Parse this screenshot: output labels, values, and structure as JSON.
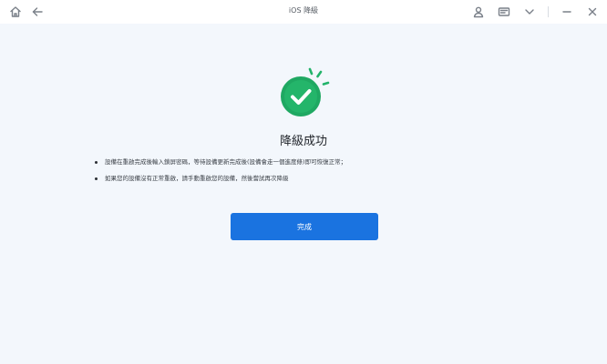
{
  "window": {
    "title": "iOS 降級",
    "left_icons": [
      "home-icon",
      "back-arrow-icon"
    ],
    "right_icons": [
      "user-icon",
      "message-icon",
      "chevron-down-icon",
      "minimize-icon",
      "close-icon"
    ]
  },
  "result": {
    "heading": "降級成功",
    "notes": [
      "設備在重啟完成後輸入鎖屏密碼，等待設備更新完成後(設備會走一個進度條)即可恢復正常；",
      "如果您的設備沒有正常重啟，請手動重啟您的設備，然後嘗試再次降級"
    ],
    "done_label": "完成"
  },
  "colors": {
    "accent": "#1a73e0",
    "success": "#22b36a",
    "background": "#f3f7fc"
  }
}
